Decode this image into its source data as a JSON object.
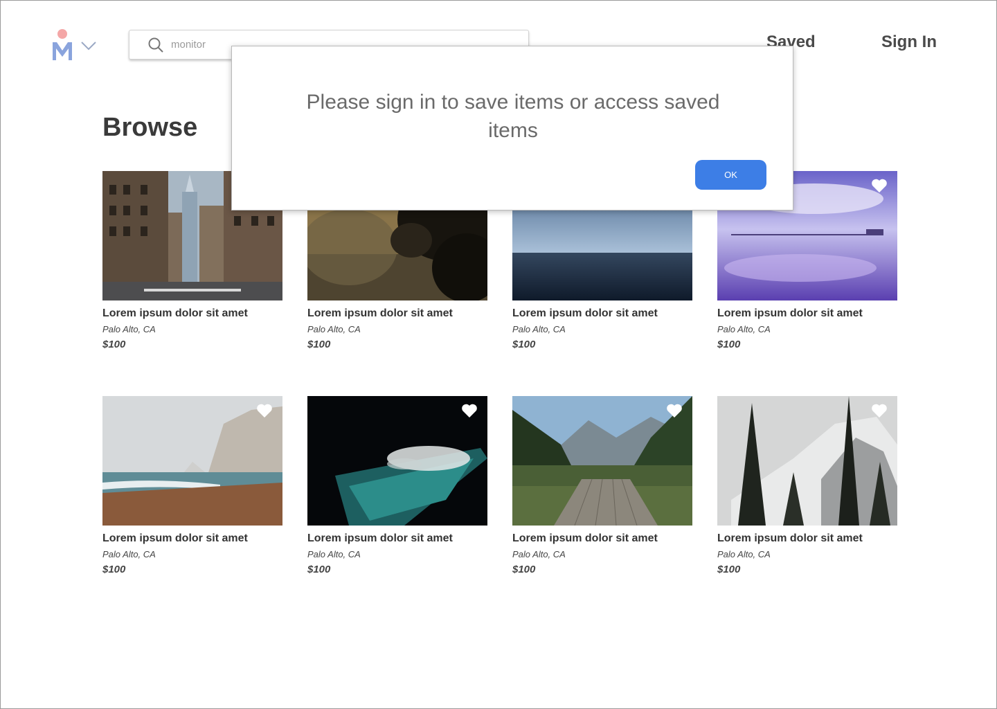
{
  "search": {
    "value": "monitor"
  },
  "nav": {
    "saved": "Saved",
    "sign_in": "Sign In"
  },
  "page": {
    "title": "Browse"
  },
  "listings": [
    {
      "title": "Lorem ipsum dolor sit amet",
      "location": "Palo Alto, CA",
      "price": "$100",
      "scene": "city street"
    },
    {
      "title": "Lorem ipsum dolor sit amet",
      "location": "Palo Alto, CA",
      "price": "$100",
      "scene": "foggy trees"
    },
    {
      "title": "Lorem ipsum dolor sit amet",
      "location": "Palo Alto, CA",
      "price": "$100",
      "scene": "ocean horizon"
    },
    {
      "title": "Lorem ipsum dolor sit amet",
      "location": "Palo Alto, CA",
      "price": "$100",
      "scene": "purple bay bridge"
    },
    {
      "title": "Lorem ipsum dolor sit amet",
      "location": "Palo Alto, CA",
      "price": "$100",
      "scene": "misty cliff beach"
    },
    {
      "title": "Lorem ipsum dolor sit amet",
      "location": "Palo Alto, CA",
      "price": "$100",
      "scene": "night ocean pool"
    },
    {
      "title": "Lorem ipsum dolor sit amet",
      "location": "Palo Alto, CA",
      "price": "$100",
      "scene": "lake with dock"
    },
    {
      "title": "Lorem ipsum dolor sit amet",
      "location": "Palo Alto, CA",
      "price": "$100",
      "scene": "snowy mountain pines"
    }
  ],
  "dialog": {
    "message": "Please sign in to save items or access saved items",
    "ok_label": "OK"
  },
  "colors": {
    "accent": "#3d7ee6",
    "logo_pink": "#f4a7a7",
    "logo_blue": "#8aa4dd"
  }
}
